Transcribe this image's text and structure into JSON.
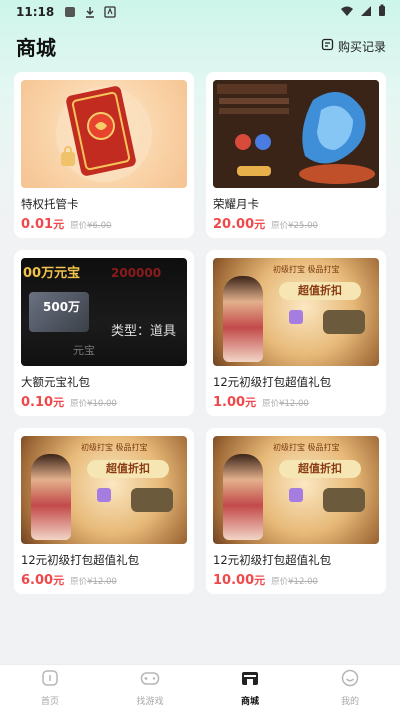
{
  "status_bar": {
    "time": "11:18",
    "battery": ""
  },
  "header": {
    "title": "商城",
    "purchase_label": "购买记录"
  },
  "products": [
    {
      "name": "特权托管卡",
      "price": "0.01",
      "unit": "元",
      "orig_label": "原价",
      "orig_price": "¥6.00",
      "art": "card"
    },
    {
      "name": "荣耀月卡",
      "price": "20.00",
      "unit": "元",
      "orig_label": "原价",
      "orig_price": "¥25.00",
      "art": "dragon"
    },
    {
      "name": "大额元宝礼包",
      "price": "0.10",
      "unit": "元",
      "orig_label": "原价",
      "orig_price": "¥10.00",
      "art": "treasure"
    },
    {
      "name": "12元初级打包超值礼包",
      "price": "1.00",
      "unit": "元",
      "orig_label": "原价",
      "orig_price": "¥12.00",
      "art": "beauty"
    },
    {
      "name": "12元初级打包超值礼包",
      "price": "6.00",
      "unit": "元",
      "orig_label": "原价",
      "orig_price": "¥12.00",
      "art": "beauty"
    },
    {
      "name": "12元初级打包超值礼包",
      "price": "10.00",
      "unit": "元",
      "orig_label": "原价",
      "orig_price": "¥12.00",
      "art": "beauty"
    }
  ],
  "thumb_text": {
    "treasure_top": "00万元宝",
    "treasure_top2": "200000",
    "treasure_box": "500万",
    "treasure_type": "类型：道具",
    "treasure_yuanbao": "元宝",
    "beauty_banner": "超值折扣",
    "beauty_banner_top": "初级打宝 极品打宝"
  },
  "tabbar": [
    {
      "label": "首页",
      "icon": "home-icon",
      "active": false
    },
    {
      "label": "找游戏",
      "icon": "gamepad-icon",
      "active": false
    },
    {
      "label": "商城",
      "icon": "shop-icon",
      "active": true
    },
    {
      "label": "我的",
      "icon": "smile-icon",
      "active": false
    }
  ],
  "colors": {
    "price_red": "#f0484a",
    "accent_mint": "#cdf5ea"
  }
}
